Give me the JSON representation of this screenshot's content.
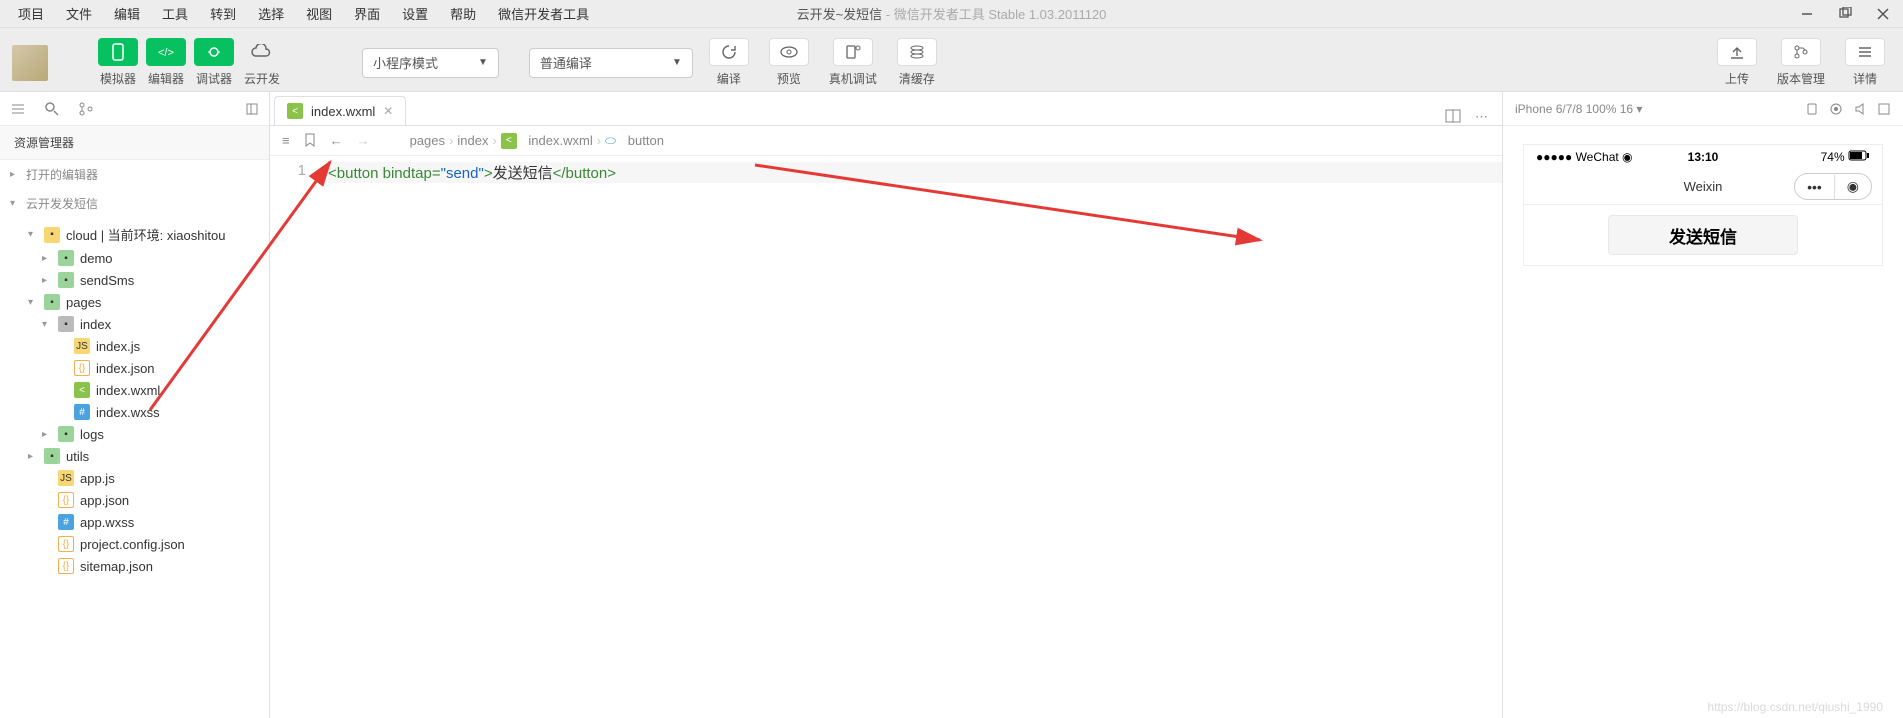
{
  "menus": [
    "项目",
    "文件",
    "编辑",
    "工具",
    "转到",
    "选择",
    "视图",
    "界面",
    "设置",
    "帮助",
    "微信开发者工具"
  ],
  "title_main": "云开发~发短信",
  "title_sub": " - 微信开发者工具 Stable 1.03.2011120",
  "toolbar": {
    "sim": "模拟器",
    "editor": "编辑器",
    "debugger": "调试器",
    "cloud": "云开发",
    "mode": "小程序模式",
    "compile_mode": "普通编译",
    "compile": "编译",
    "preview": "预览",
    "remote": "真机调试",
    "clear": "清缓存",
    "upload": "上传",
    "version": "版本管理",
    "detail": "详情"
  },
  "sidebar": {
    "panel_title": "资源管理器",
    "open_editors": "打开的编辑器",
    "project_name": "云开发发短信",
    "tree": [
      {
        "chev": "▾",
        "icon": "fi-folder-y",
        "label": "cloud | 当前环境: xiaoshitou",
        "indent": 1
      },
      {
        "chev": "▸",
        "icon": "fi-folder-g",
        "label": "demo",
        "indent": 2
      },
      {
        "chev": "▸",
        "icon": "fi-folder-g",
        "label": "sendSms",
        "indent": 2
      },
      {
        "chev": "▾",
        "icon": "fi-folder-g",
        "label": "pages",
        "indent": 1
      },
      {
        "chev": "▾",
        "icon": "fi-folder-gy",
        "label": "index",
        "indent": 2
      },
      {
        "chev": "",
        "icon": "fi-js",
        "label": "index.js",
        "indent": 3
      },
      {
        "chev": "",
        "icon": "fi-json",
        "label": "index.json",
        "indent": 3
      },
      {
        "chev": "",
        "icon": "fi-wxml",
        "label": "index.wxml",
        "indent": 3
      },
      {
        "chev": "",
        "icon": "fi-wxss",
        "label": "index.wxss",
        "indent": 3
      },
      {
        "chev": "▸",
        "icon": "fi-folder-g",
        "label": "logs",
        "indent": 2
      },
      {
        "chev": "▸",
        "icon": "fi-folder-g",
        "label": "utils",
        "indent": 1
      },
      {
        "chev": "",
        "icon": "fi-js",
        "label": "app.js",
        "indent": 2
      },
      {
        "chev": "",
        "icon": "fi-json",
        "label": "app.json",
        "indent": 2
      },
      {
        "chev": "",
        "icon": "fi-wxss",
        "label": "app.wxss",
        "indent": 2
      },
      {
        "chev": "",
        "icon": "fi-json",
        "label": "project.config.json",
        "indent": 2
      },
      {
        "chev": "",
        "icon": "fi-json",
        "label": "sitemap.json",
        "indent": 2
      }
    ]
  },
  "editor": {
    "tab_name": "index.wxml",
    "crumbs": [
      "pages",
      "index",
      "index.wxml",
      "button"
    ],
    "line_number": "1",
    "code_open": "<button",
    "code_attr": " bindtap",
    "code_eq": "=",
    "code_str": "\"send\"",
    "code_close": ">",
    "code_text": "发送短信",
    "code_end": "</button>"
  },
  "preview": {
    "device": "iPhone 6/7/8 100% 16 ▾",
    "carrier": "●●●●● WeChat",
    "time": "13:10",
    "battery": "74%",
    "app_title": "Weixin",
    "button_text": "发送短信"
  },
  "watermark": "https://blog.csdn.net/qiushi_1990"
}
